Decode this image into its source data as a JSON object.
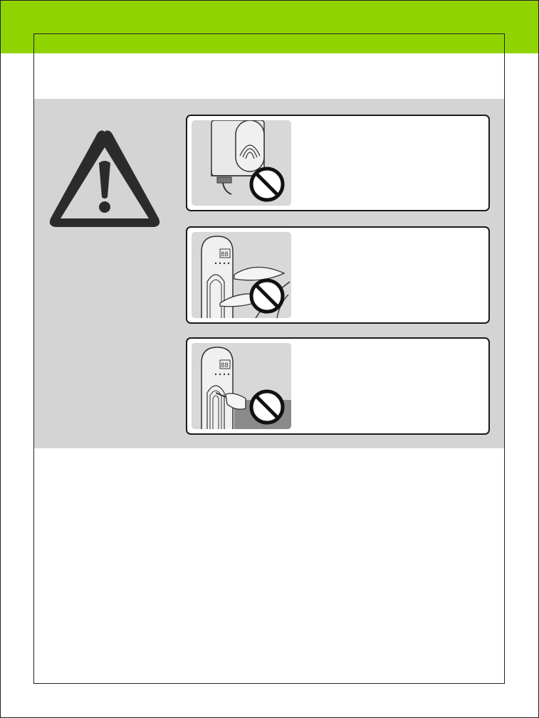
{
  "page": {
    "accent_color": "#8fd400",
    "panel_color": "#d4d4d4"
  },
  "warning": {
    "icon": "warning-triangle-icon",
    "items": [
      {
        "caption": "",
        "illustration": "tower-fan-base-cord-illustration",
        "badge": "prohibited-icon"
      },
      {
        "caption": "",
        "illustration": "plant-near-fan-illustration",
        "badge": "prohibited-icon"
      },
      {
        "caption": "",
        "illustration": "hand-inserting-object-illustration",
        "badge": "prohibited-icon"
      }
    ]
  }
}
